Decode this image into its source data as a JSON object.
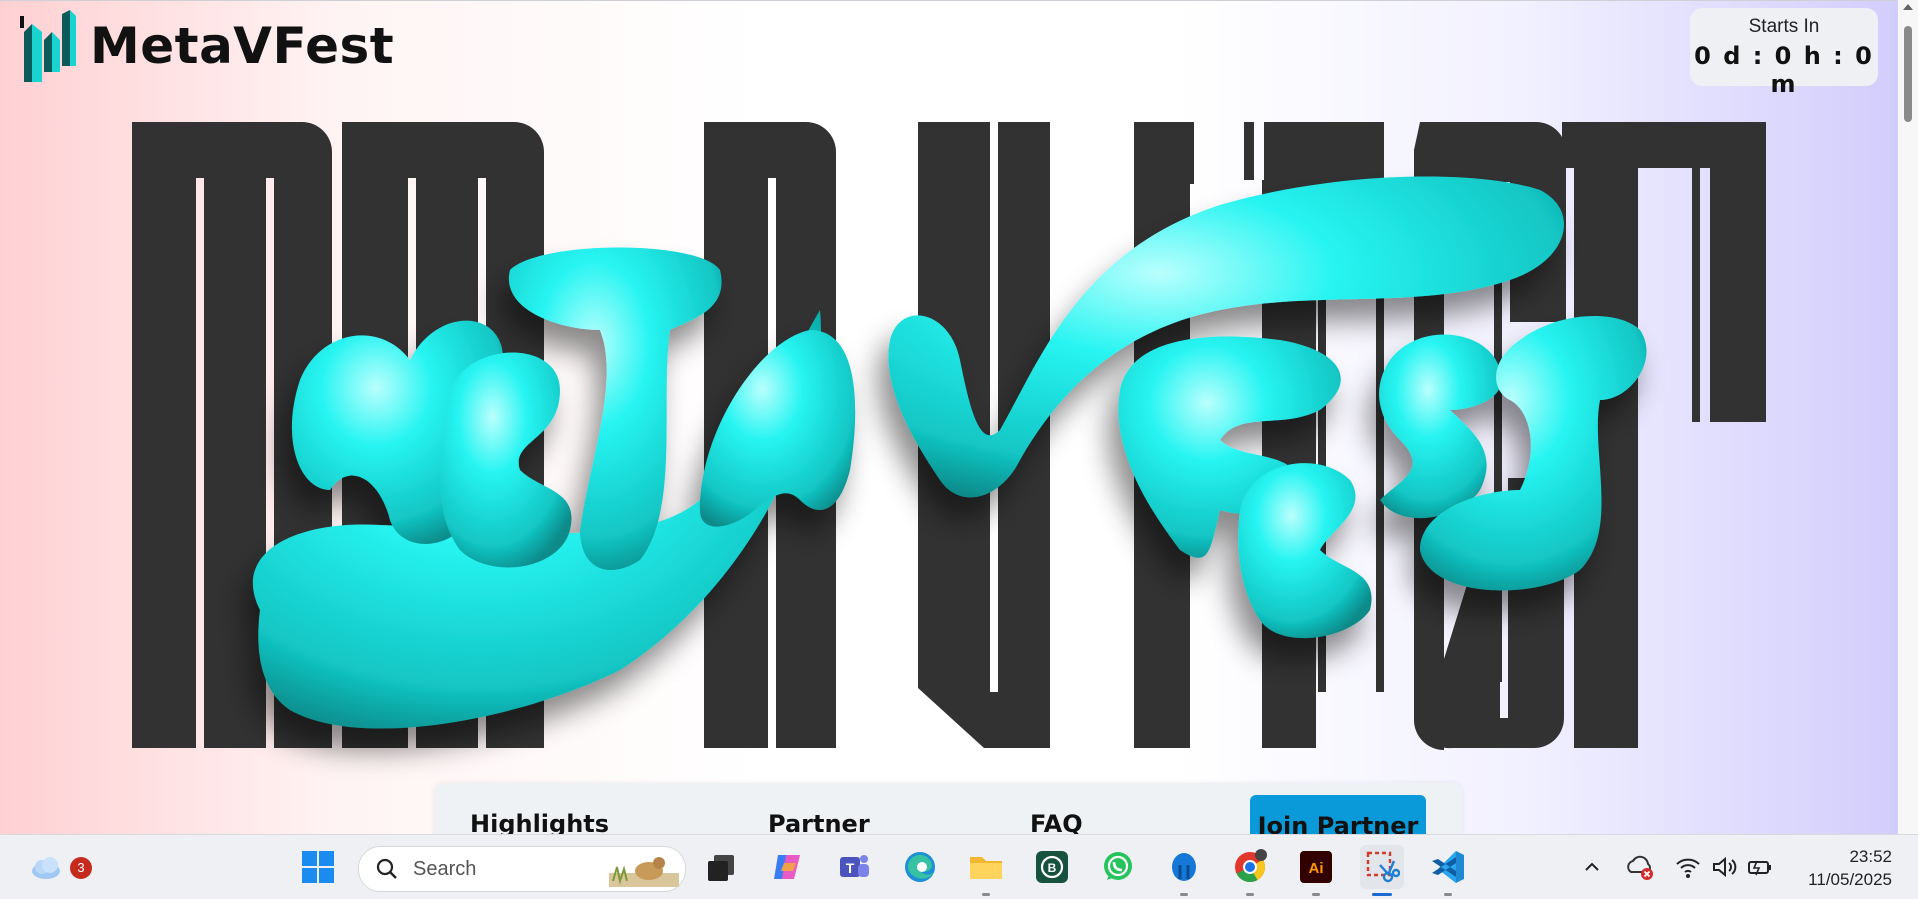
{
  "site": {
    "name": "MetaVFest",
    "countdown_label": "Starts In",
    "countdown_value": "0 d : 0 h : 0 m"
  },
  "nav": {
    "items": [
      "Highlights",
      "Partner",
      "FAQ"
    ],
    "cta_label": "Join Partner"
  },
  "colors": {
    "accent": "#0a9ad9",
    "hero_letters": "#323232",
    "bubble": "#1ef0ee"
  },
  "taskbar": {
    "weather_badge": "3",
    "search_placeholder": "Search",
    "time": "23:52",
    "date": "11/05/2025",
    "icons": [
      "weather-icon",
      "windows-start-icon",
      "search-icon",
      "task-view-icon",
      "copilot-icon",
      "teams-icon",
      "edge-icon",
      "file-explorer-icon",
      "whatsapp-business-icon",
      "whatsapp-icon",
      "onedrive-icon",
      "chrome-icon",
      "illustrator-icon",
      "snipping-tool-icon",
      "vscode-icon",
      "tray-chevron-icon",
      "cloud-sync-error-icon",
      "wifi-icon",
      "volume-icon",
      "battery-icon"
    ]
  }
}
